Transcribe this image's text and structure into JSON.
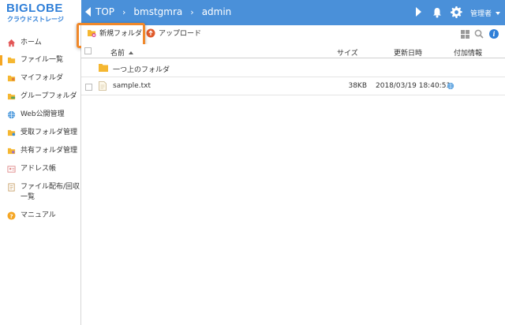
{
  "brand": {
    "name": "BIGLOBE",
    "subtitle": "クラウドストレージ"
  },
  "breadcrumb": [
    "TOP",
    "bmstgmra",
    "admin"
  ],
  "breadcrumb_sep": "›",
  "user": {
    "label": "管理者"
  },
  "sidebar": {
    "items": [
      {
        "label": "ホーム",
        "icon": "home-icon"
      },
      {
        "label": "ファイル一覧",
        "icon": "folder-icon",
        "active": true
      },
      {
        "label": "マイフォルダ",
        "icon": "my-folder-icon"
      },
      {
        "label": "グループフォルダ",
        "icon": "group-folder-icon"
      },
      {
        "label": "Web公開管理",
        "icon": "globe-icon"
      },
      {
        "label": "受取フォルダ管理",
        "icon": "receive-folder-icon"
      },
      {
        "label": "共有フォルダ管理",
        "icon": "shared-folder-icon"
      },
      {
        "label": "アドレス帳",
        "icon": "address-book-icon"
      },
      {
        "label": "ファイル配布/回収一覧",
        "icon": "distribution-icon"
      },
      {
        "label": "マニュアル",
        "icon": "help-icon"
      }
    ]
  },
  "toolbar": {
    "new_folder": "新規フォルダ",
    "upload": "アップロード",
    "info": "i"
  },
  "table": {
    "headers": {
      "name": "名前",
      "size": "サイズ",
      "updated": "更新日時",
      "attached": "付加情報"
    },
    "parent_row": "一つ上のフォルダ",
    "rows": [
      {
        "name": "sample.txt",
        "size": "38KB",
        "updated": "2018/03/19 18:40:51",
        "info": "globe-icon"
      }
    ]
  },
  "colors": {
    "header": "#4a90d9",
    "accent": "#f5a623",
    "highlight": "#f0882a",
    "brand": "#2f7fd8"
  }
}
